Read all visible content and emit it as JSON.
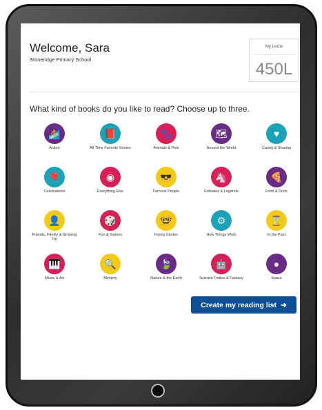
{
  "header": {
    "welcome": "Welcome, Sara",
    "school": "Stoneridge Primary School"
  },
  "lexile": {
    "label": "My Lexile",
    "value": "450L"
  },
  "question": "What kind of books do you like to read? Choose up to three.",
  "genres": [
    {
      "label": "Action",
      "icon": "surfer-icon",
      "color": "#6a2b86"
    },
    {
      "label": "All Time Favorite Stories",
      "icon": "book-icon",
      "color": "#1aa3b8"
    },
    {
      "label": "Animals & Pets",
      "icon": "paw-icon",
      "color": "#d81f57"
    },
    {
      "label": "Around the World",
      "icon": "map-icon",
      "color": "#6a2b86"
    },
    {
      "label": "Caring & Sharing",
      "icon": "heart-icon",
      "color": "#1aa3b8"
    },
    {
      "label": "Celebrations",
      "icon": "balloon-icon",
      "color": "#1aa3b8"
    },
    {
      "label": "Everything Else",
      "icon": "target-icon",
      "color": "#d81f57"
    },
    {
      "label": "Famous People",
      "icon": "sunglasses-icon",
      "color": "#f3cb17"
    },
    {
      "label": "Folktales & Legends",
      "icon": "unicorn-icon",
      "color": "#d81f57"
    },
    {
      "label": "Food & Drink",
      "icon": "pizza-icon",
      "color": "#6a2b86"
    },
    {
      "label": "Friends, Family & Growing Up",
      "icon": "person-icon",
      "color": "#f3cb17"
    },
    {
      "label": "Fun & Games",
      "icon": "game-cube-icon",
      "color": "#d81f57"
    },
    {
      "label": "Funny Stories",
      "icon": "glasses-face-icon",
      "color": "#f3cb17"
    },
    {
      "label": "How Things Work",
      "icon": "gears-icon",
      "color": "#1aa3b8"
    },
    {
      "label": "In the Past",
      "icon": "hourglass-icon",
      "color": "#f3cb17"
    },
    {
      "label": "Music & Art",
      "icon": "piano-icon",
      "color": "#d81f57"
    },
    {
      "label": "Mystery",
      "icon": "magnifier-icon",
      "color": "#f3cb17"
    },
    {
      "label": "Nature & the Earth",
      "icon": "leaf-icon",
      "color": "#6a2b86"
    },
    {
      "label": "Science Fiction & Fantasy",
      "icon": "robot-icon",
      "color": "#d81f57"
    },
    {
      "label": "Space",
      "icon": "moon-icon",
      "color": "#6a2b86"
    }
  ],
  "cta": {
    "label": "Create my reading list",
    "arrow": "➜"
  }
}
